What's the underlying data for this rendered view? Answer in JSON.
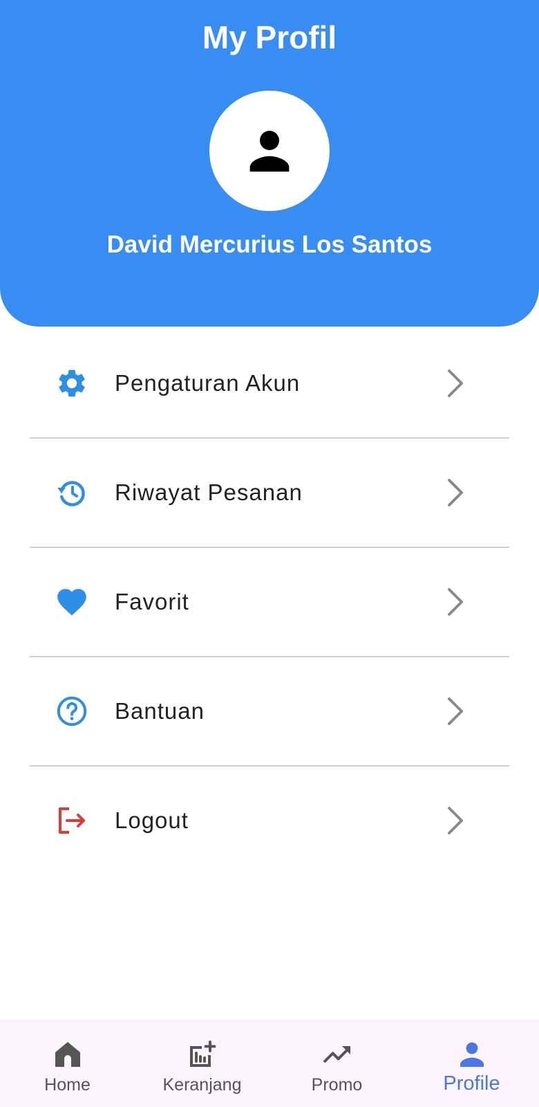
{
  "header": {
    "title": "My Profil",
    "user_name": "David Mercurius Los Santos",
    "background_color": "#378DF1"
  },
  "menu": {
    "items": [
      {
        "label": "Pengaturan Akun",
        "icon": "gear-icon",
        "color": "#2E8FE8"
      },
      {
        "label": "Riwayat Pesanan",
        "icon": "history-icon",
        "color": "#2E8FE8"
      },
      {
        "label": "Favorit",
        "icon": "heart-icon",
        "color": "#2E8FE8"
      },
      {
        "label": "Bantuan",
        "icon": "help-circle-icon",
        "color": "#2E8FE8"
      },
      {
        "label": "Logout",
        "icon": "logout-icon",
        "color": "#E53935"
      }
    ]
  },
  "bottom_nav": {
    "items": [
      {
        "label": "Home",
        "icon": "home-icon"
      },
      {
        "label": "Keranjang",
        "icon": "cart-chart-icon"
      },
      {
        "label": "Promo",
        "icon": "trending-up-icon"
      },
      {
        "label": "Profile",
        "icon": "person-icon",
        "active": true
      }
    ],
    "active_color": "#4B77E6"
  }
}
